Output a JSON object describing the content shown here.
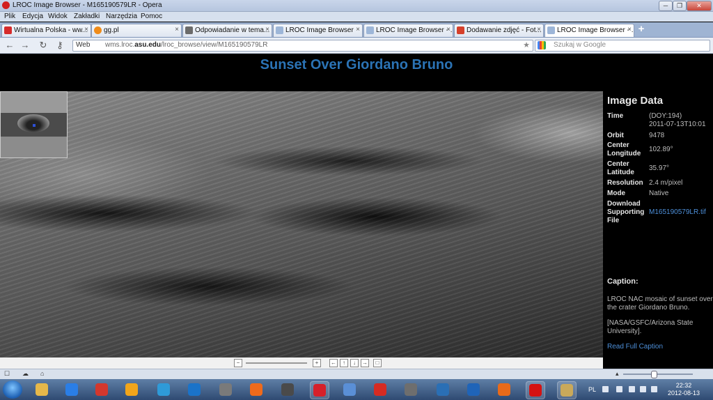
{
  "window": {
    "title": "LROC Image Browser - M165190579LR - Opera",
    "controls": [
      "─",
      "❐",
      "✕"
    ]
  },
  "menu": [
    "Plik",
    "Edycja",
    "Widok",
    "Zakładki",
    "Narzędzia",
    "Pomoc"
  ],
  "tabs": [
    {
      "label": "Wirtualna Polska - ww...",
      "color": "#d62b2b"
    },
    {
      "label": "gg.pl",
      "color": "#f08c1a"
    },
    {
      "label": "Odpowiadanie w tema...",
      "color": "#6b6b6b"
    },
    {
      "label": "LROC Image Browser",
      "color": "#9db6d8"
    },
    {
      "label": "LROC Image Browser - ...",
      "color": "#9db6d8"
    },
    {
      "label": "Dodawanie zdjęć - Fot...",
      "color": "#d6402b"
    },
    {
      "label": "LROC Image Browser - ...",
      "color": "#9db6d8"
    }
  ],
  "tab_close": "×",
  "new_tab": "+",
  "nav": {
    "back": "←",
    "forward": "→",
    "reload": "↻",
    "key": "⚷",
    "web_label": "Web",
    "url_prefix": "wms.lroc.",
    "url_domain": "asu.edu",
    "url_path": "/lroc_browse/view/M165190579LR",
    "star": "★",
    "search_placeholder": "Szukaj w Google"
  },
  "page": {
    "title": "Sunset Over Giordano Bruno"
  },
  "image_data": {
    "heading": "Image Data",
    "rows": [
      {
        "label": "Time",
        "value": "(DOY:194)"
      },
      {
        "label": "",
        "value": "2011-07-13T10:01"
      },
      {
        "label": "Orbit",
        "value": "9478"
      },
      {
        "label": "Center Longitude",
        "value": "102.89°"
      },
      {
        "label": "Center Latitude",
        "value": "35.97°"
      },
      {
        "label": "Resolution",
        "value": "2.4 m/pixel"
      },
      {
        "label": "Mode",
        "value": "Native"
      },
      {
        "label": "Download Supporting File",
        "value": "M165190579LR.tif"
      }
    ],
    "caption_title": "Caption:",
    "caption_text": "LROC NAC mosaic of sunset over the crater Giordano Bruno.",
    "caption_credit": "[NASA/GSFC/Arizona State University].",
    "read_more": "Read Full Caption"
  },
  "controls": {
    "zoom_out": "−",
    "zoom_in": "+",
    "pan": [
      "←",
      "↑",
      "↓",
      "→",
      "□"
    ]
  },
  "status": {
    "items": [
      "☐",
      "☁",
      "⌂"
    ],
    "zoom_arrow": "▴"
  },
  "taskbar": {
    "apps": [
      {
        "name": "explorer",
        "color": "#e6b84a"
      },
      {
        "name": "winamp",
        "color": "#2a7ee6"
      },
      {
        "name": "photo-gallery",
        "color": "#d3372d"
      },
      {
        "name": "media-player",
        "color": "#f2a51a"
      },
      {
        "name": "ie-browser",
        "color": "#2e9ad8"
      },
      {
        "name": "bc",
        "color": "#1a73c9"
      },
      {
        "name": "mouse",
        "color": "#7a7a7a"
      },
      {
        "name": "origin",
        "color": "#ef6a1b"
      },
      {
        "name": "ea",
        "color": "#4a4a4a"
      },
      {
        "name": "star-app",
        "color": "#d6202a"
      },
      {
        "name": "globe",
        "color": "#5a8fd6"
      },
      {
        "name": "flash",
        "color": "#d62b22"
      },
      {
        "name": "mouse2",
        "color": "#6e6e6e"
      },
      {
        "name": "steam",
        "color": "#2a6fb5"
      },
      {
        "name": "monitor",
        "color": "#1f64b8"
      },
      {
        "name": "firefox",
        "color": "#e86a1a"
      },
      {
        "name": "opera",
        "color": "#d51212"
      },
      {
        "name": "paint",
        "color": "#c9a95a"
      }
    ],
    "lang": "PL",
    "time": "22:32",
    "date": "2012-08-13"
  }
}
